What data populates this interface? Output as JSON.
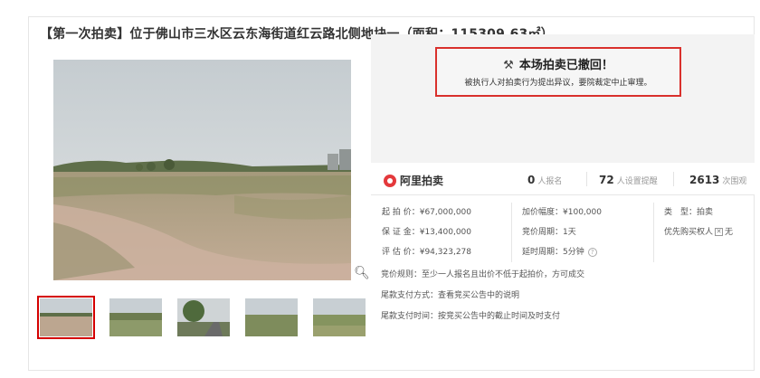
{
  "page": {
    "title": "【第一次拍卖】位于佛山市三水区云东海街道红云路北侧地块一（面积：115309.63㎡）"
  },
  "notice": {
    "title": "本场拍卖已撤回！",
    "description": "被执行人对拍卖行为提出异议，要院裁定中止审理。"
  },
  "brand": {
    "name": "阿里拍卖",
    "logo_color": "#e4393c"
  },
  "stats": [
    {
      "num": "0",
      "label": "人报名"
    },
    {
      "num": "72",
      "label": "人设置提醒"
    },
    {
      "num": "2613",
      "label": "次围观"
    }
  ],
  "info": {
    "starting_price_label": "起 拍 价：",
    "starting_price": "¥67,000,000",
    "deposit_label": "保 证 金：",
    "deposit": "¥13,400,000",
    "appraisal_label": "评 估 价：",
    "appraisal": "¥94,323,278",
    "increment_label": "加价幅度：",
    "increment": "¥100,000",
    "bid_period_label": "竞价周期：",
    "bid_period": "1天",
    "delay_label": "延时周期：",
    "delay": "5分钟",
    "type_label": "类　型：",
    "type": "拍卖",
    "priority_label": "优先购买权人",
    "priority": "无"
  },
  "rules": {
    "bid_rule_label": "竞价规则：",
    "bid_rule": "至少一人报名且出价不低于起拍价，方可成交",
    "payment_method_label": "尾款支付方式：",
    "payment_method": "查看竞买公告中的说明",
    "payment_time_label": "尾款支付时间：",
    "payment_time": "按竞买公告中的截止时间及时支付"
  },
  "colors": {
    "accent": "#d9302c",
    "panel_bg": "#f3f3f3"
  },
  "icons": {
    "gavel": "gavel-icon",
    "zoom": "zoom-icon",
    "help": "help-icon",
    "cross": "cross-icon"
  }
}
